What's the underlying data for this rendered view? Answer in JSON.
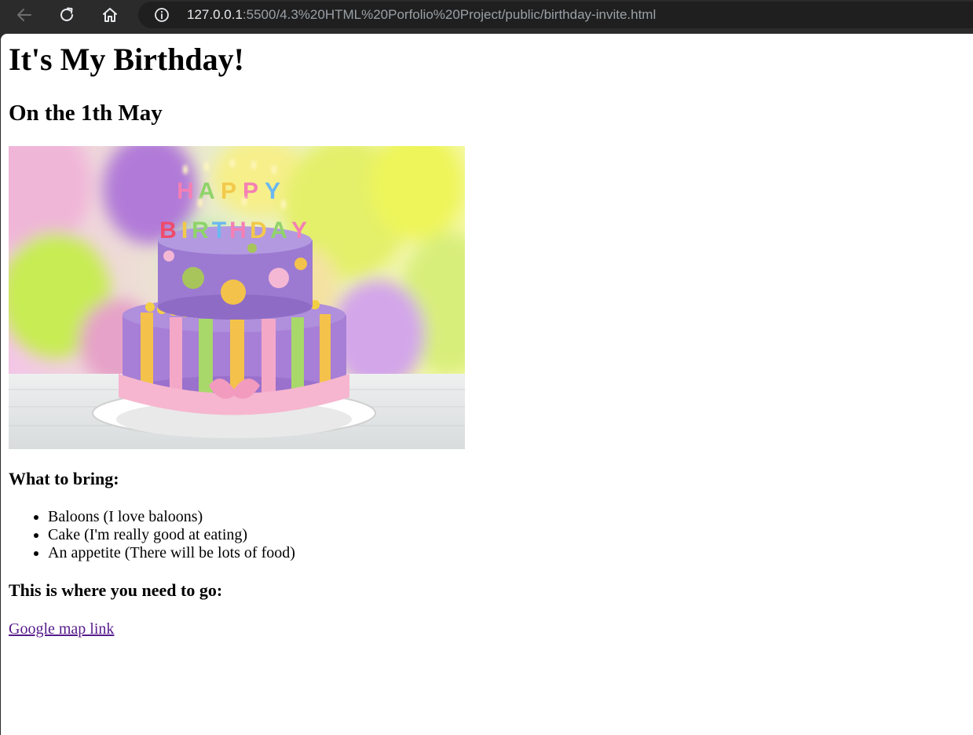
{
  "browser": {
    "url_host": "127.0.0.1",
    "url_path": ":5500/4.3%20HTML%20Porfolio%20Project/public/birthday-invite.html",
    "icons": [
      "back-arrow-icon",
      "reload-icon",
      "home-icon",
      "site-info-icon"
    ],
    "colors": {
      "chrome": "#2b2b2b",
      "omnibox": "#1f1f1f",
      "url_host": "#e8eaed",
      "url_path": "#9aa0a6"
    }
  },
  "page": {
    "title": "It's My Birthday!",
    "date": "On the 1th May",
    "image": {
      "alt": "Happy Birthday cake with candles and balloons",
      "caption_on_cake_line1": "HAPPY",
      "caption_on_cake_line2": "BIRTHDAY"
    },
    "bring_heading": "What to bring:",
    "bring_items": [
      "Baloons (I love baloons)",
      "Cake (I'm really good at eating)",
      "An appetite (There will be lots of food)"
    ],
    "where_heading": "This is where you need to go:",
    "map_link_text": "Google map link",
    "colors": {
      "background": "#ffffff",
      "text": "#000000",
      "visited_link": "#551a8b"
    }
  }
}
